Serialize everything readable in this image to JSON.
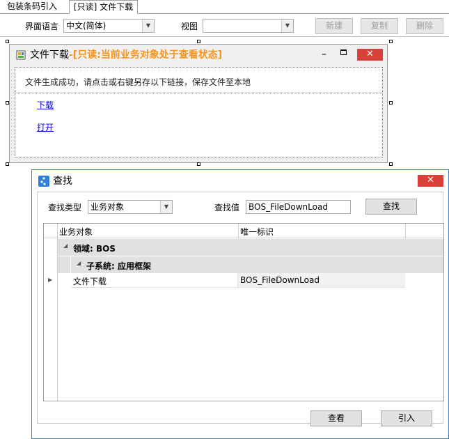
{
  "tabs": [
    {
      "label": "包装条码引入",
      "active": false
    },
    {
      "label": "[只读] 文件下载",
      "active": true
    }
  ],
  "toolbar": {
    "language_label": "界面语言",
    "language_value": "中文(简体)",
    "view_label": "视图",
    "view_value": "",
    "new_label": "新建",
    "copy_label": "复制",
    "delete_label": "删除"
  },
  "file_window": {
    "title": "文件下载",
    "title_readonly": "-[只读:当前业务对象处于查看状态]",
    "readonly_color": "#f7941d",
    "message": "文件生成成功，请点击或右键另存以下链接，保存文件至本地",
    "download_link": "下载",
    "open_link": "打开"
  },
  "find_dialog": {
    "title": "查找",
    "search_type_label": "查找类型",
    "search_type_value": "业务对象",
    "search_value_label": "查找值",
    "search_value": "BOS_FileDownLoad",
    "search_button": "查找",
    "columns": [
      "业务对象",
      "唯一标识"
    ],
    "group_domain": "领域: BOS",
    "group_subsystem": "子系统: 应用框架",
    "rows": [
      {
        "object": "文件下载",
        "key": "BOS_FileDownLoad"
      }
    ],
    "view_button": "查看",
    "import_button": "引入",
    "accent": "#3d7fc7",
    "close_color": "#d9403a"
  }
}
